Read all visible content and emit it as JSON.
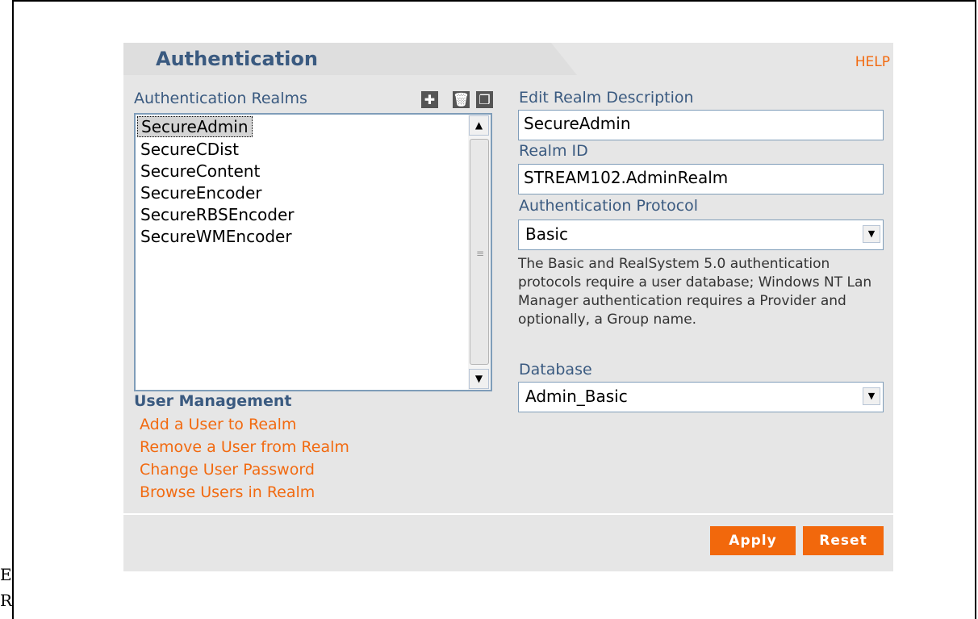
{
  "edge_glyphs": [
    "E",
    "R"
  ],
  "header": {
    "title": "Authentication",
    "help_label": "HELP"
  },
  "realms": {
    "label": "Authentication Realms",
    "toolbar": {
      "add_icon": "plus-icon",
      "delete_icon": "trash-icon",
      "copy_icon": "copy-icon"
    },
    "items": [
      "SecureAdmin",
      "SecureCDist",
      "SecureContent",
      "SecureEncoder",
      "SecureRBSEncoder",
      "SecureWMEncoder"
    ],
    "selected": "SecureAdmin"
  },
  "editor": {
    "description_label": "Edit Realm Description",
    "description_value": "SecureAdmin",
    "realm_id_label": "Realm ID",
    "realm_id_value": "STREAM102.AdminRealm",
    "protocol_label": "Authentication Protocol",
    "protocol_value": "Basic",
    "protocol_help": "The Basic and RealSystem 5.0 authentication protocols require a user database; Windows NT Lan Manager authentication requires a Provider and optionally, a Group name.",
    "database_label": "Database",
    "database_value": "Admin_Basic"
  },
  "user_management": {
    "title": "User Management",
    "links": [
      "Add a User to Realm",
      "Remove a User from Realm",
      "Change User Password",
      "Browse Users in Realm"
    ]
  },
  "footer": {
    "apply_label": "Apply",
    "reset_label": "Reset"
  },
  "colors": {
    "accent": "#f26a10",
    "heading": "#3a5a80",
    "panel": "#e6e6e6"
  }
}
